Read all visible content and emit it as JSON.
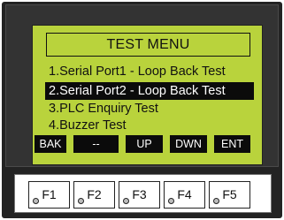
{
  "screen": {
    "title": "TEST MENU",
    "menu_items": [
      "1.Serial Port1 - Loop Back Test",
      "2.Serial Port2 - Loop Back Test",
      "3.PLC Enquiry Test",
      "4.Buzzer Test"
    ],
    "selected_index": 1
  },
  "softkeys": [
    "BAK",
    "--",
    "UP",
    "DWN",
    "ENT"
  ],
  "function_keys": [
    "F1",
    "F2",
    "F3",
    "F4",
    "F5"
  ],
  "colors": {
    "lcd_background": "#b9d33c",
    "device_body": "#232323",
    "highlight": "#0b0b0b"
  }
}
